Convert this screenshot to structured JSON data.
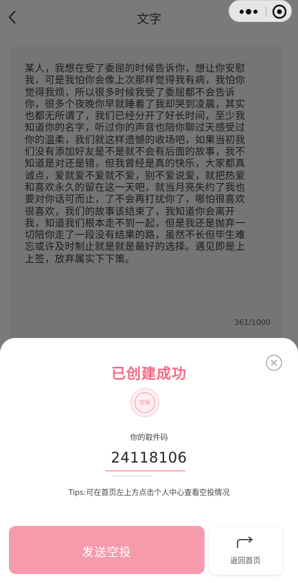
{
  "nav": {
    "title": "文字",
    "back_icon": "chevron-left-icon",
    "more_icon": "more-dots-icon",
    "close_icon": "target-circle-icon"
  },
  "content": {
    "text": "某人，我想在受了委屈的时候告诉你，想让你安慰我，可是我怕你会像上次那样觉得我有病，我怕你觉得我烦，所以很多时候我受了委屈都不会告诉你，很多个夜晚你早就睡着了我却哭到凌晨，其实也都无所谓了，我们已经分开了好长时间，至少我知道你的名字，听过你的声音也陪你聊过天感受过你的温柔，我们就这样遗憾的收场吧，如果当初我们没有添加好友是不是就不会有后面的故事，我不知道是对还是错，但我曾经是真的快乐，大家都真诚点，爱就爱不爱就不爱，别不爱说爱，就把热爱和喜欢永久的留在这一天吧，就当月亮失约了我也要对你话可而止，了不会再打扰你了，哪怕很喜欢很喜欢，我们的故事该结束了，我知道你会离开我，知道我们根本走不到一起，但是我还是抛弃一切陪你走了一段没有结果的路，虽然不长但毕生难忘或许及时制止就是就是最好的选择。遇见即是上上签，放弃属实下下策。",
    "counter": "361/1000"
  },
  "sheet": {
    "title": "已创建成功",
    "badge_text": "空投",
    "code_label": "你的取件码",
    "code_value": "24118106",
    "tips": "Tips:可在首页左上方点击个人中心查看空投情况",
    "send_button": "发送空投",
    "home_button": "返回首页",
    "close_icon": "close-circle-icon",
    "home_icon": "return-arrow-icon"
  },
  "colors": {
    "accent": "#f46a86",
    "button_pink": "#f69bab",
    "overlay": "#7a7a7a"
  }
}
